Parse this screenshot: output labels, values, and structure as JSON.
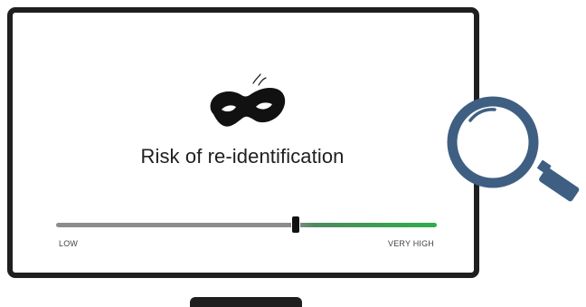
{
  "title": "Risk of re-identification",
  "risk_meter": {
    "min_label": "LOW",
    "max_label": "VERY HIGH",
    "level": 0.63,
    "track_colors": [
      "#8c8c8c",
      "#2eae4a"
    ]
  },
  "icons": {
    "center": "mask-icon",
    "side": "magnifying-glass-icon"
  },
  "colors": {
    "frame": "#1f1f1f",
    "magnifier": "#3f5f82"
  }
}
